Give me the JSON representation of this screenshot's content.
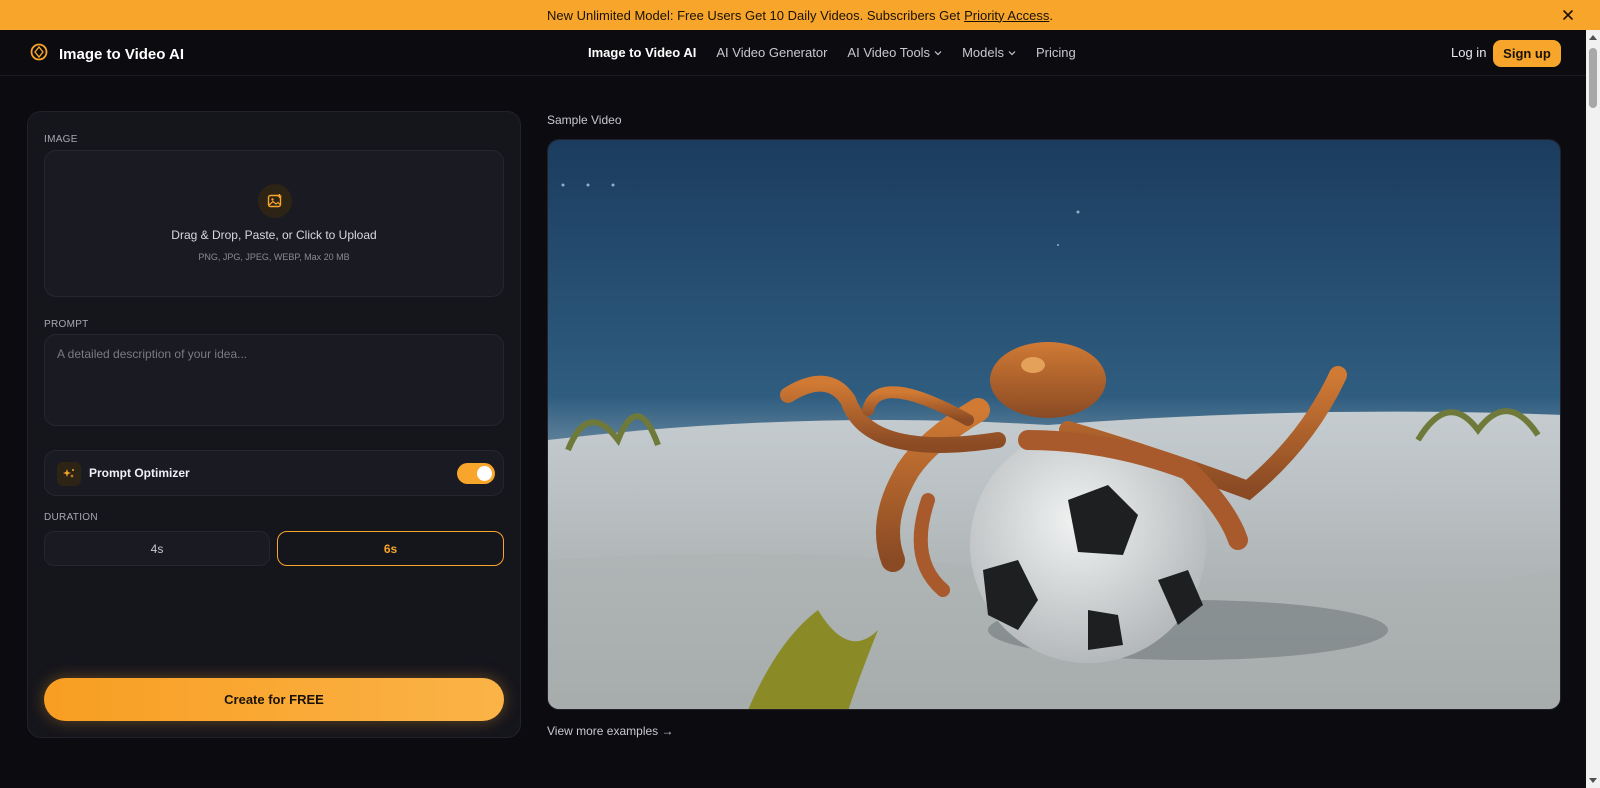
{
  "banner": {
    "text": "New Unlimited Model: Free Users Get 10 Daily Videos. Subscribers Get",
    "link": "Priority Access",
    "suffix": "."
  },
  "header": {
    "logo_text": "Image to Video AI",
    "nav": [
      {
        "label": "Image to Video AI",
        "active": true
      },
      {
        "label": "AI Video Generator"
      },
      {
        "label": "AI Video Tools",
        "dropdown": true
      },
      {
        "label": "Models",
        "dropdown": true
      },
      {
        "label": "Pricing"
      }
    ],
    "login": "Log in",
    "signup": "Sign up"
  },
  "form": {
    "image_label": "IMAGE",
    "upload_title": "Drag & Drop, Paste, or Click to Upload",
    "upload_sub": "PNG, JPG, JPEG, WEBP, Max 20 MB",
    "prompt_label": "PROMPT",
    "prompt_value": "",
    "prompt_placeholder": "A detailed description of your idea...",
    "optimizer_label": "Prompt Optimizer",
    "optimizer_on": true,
    "duration_label": "DURATION",
    "durations": [
      "4s",
      "6s"
    ],
    "selected_duration": "6s",
    "create_label": "Create for FREE"
  },
  "preview": {
    "sample_label": "Sample Video",
    "more_link": "View more examples →"
  },
  "colors": {
    "accent": "#f8a52b",
    "background": "#0b0b10",
    "panel": "#15151c"
  },
  "icons": {
    "logo": "aperture-icon",
    "close": "close-icon",
    "upload": "image-plus-icon",
    "optimizer": "sparkles-icon",
    "dropdown": "chevron-down-icon"
  }
}
